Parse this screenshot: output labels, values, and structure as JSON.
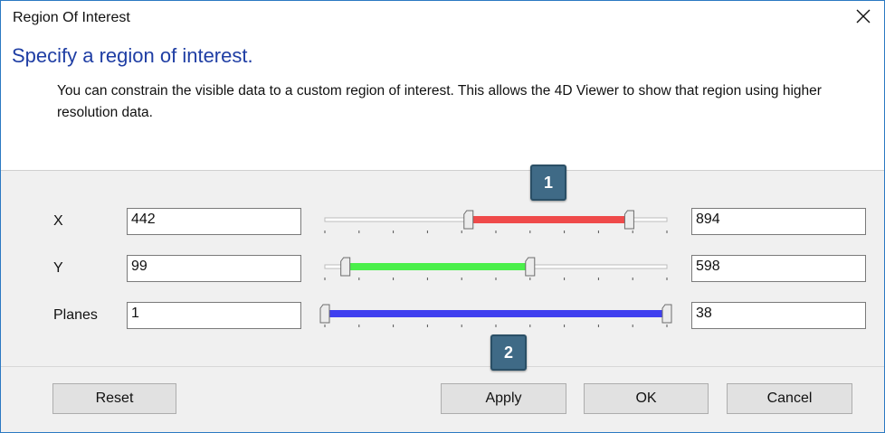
{
  "window": {
    "title": "Region Of Interest"
  },
  "header": {
    "title": "Specify a region of interest.",
    "description": "You can constrain the visible data to a custom region of interest. This allows the 4D Viewer to show that region using higher resolution data."
  },
  "rows": [
    {
      "label": "X",
      "min": "442",
      "max": "894",
      "color": "#ef4a4a"
    },
    {
      "label": "Y",
      "min": "99",
      "max": "598",
      "color": "#4aef4a"
    },
    {
      "label": "Planes",
      "min": "1",
      "max": "38",
      "color": "#3f3fef"
    }
  ],
  "sliders": {
    "x": {
      "low": 0.42,
      "high": 0.89
    },
    "y": {
      "low": 0.06,
      "high": 0.6
    },
    "planes": {
      "low": 0.0,
      "high": 1.0
    }
  },
  "buttons": {
    "reset": "Reset",
    "apply": "Apply",
    "ok": "OK",
    "cancel": "Cancel"
  },
  "callouts": {
    "one": "1",
    "two": "2"
  },
  "icons": {
    "close": "close-icon"
  }
}
